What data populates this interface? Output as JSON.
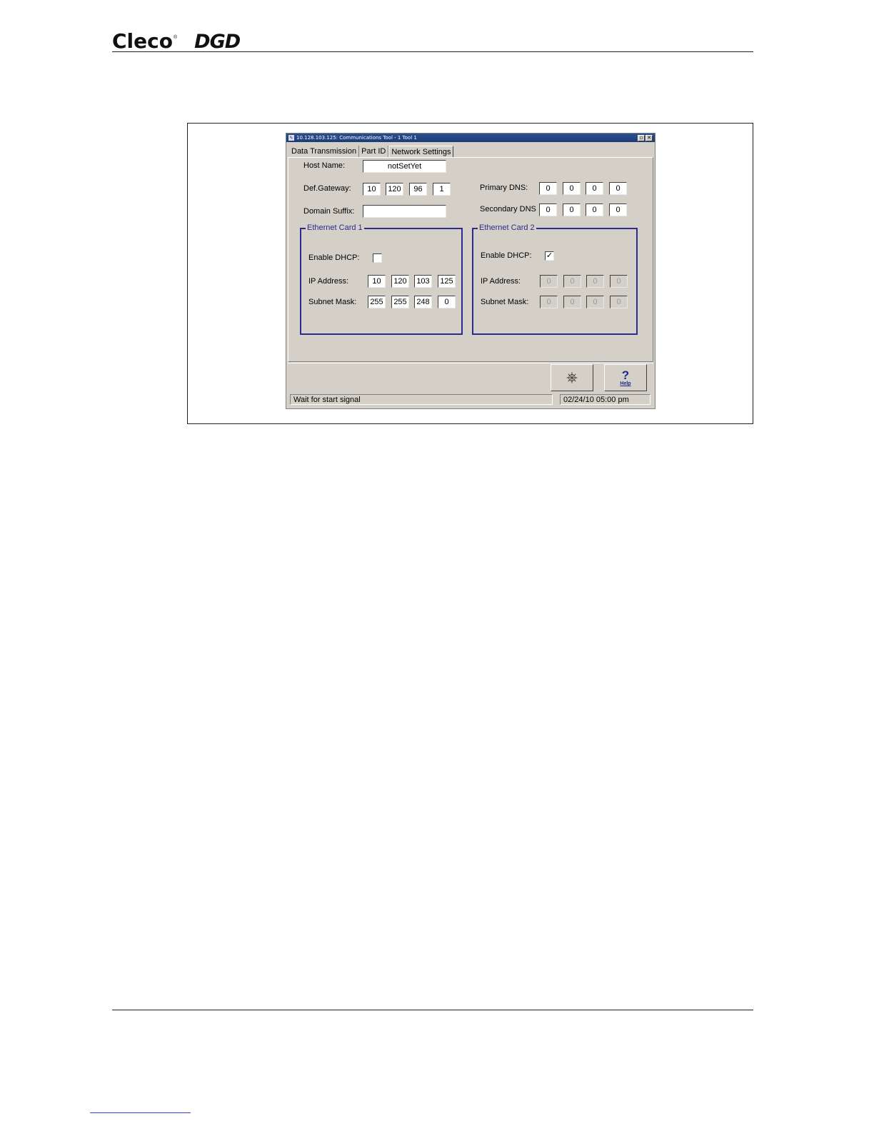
{
  "header": {
    "brand_primary": "Cleco",
    "brand_reg": "®",
    "brand_secondary": "DGD"
  },
  "window": {
    "title": "10.128.103.125: Communications   Tool - 1   Tool 1",
    "buttons": {
      "restore": "▫",
      "close": "✕"
    }
  },
  "tabs": [
    "Data Transmission",
    "Part ID",
    "Network Settings"
  ],
  "form": {
    "host_name_label": "Host Name:",
    "host_name_value": "notSetYet",
    "def_gateway_label": "Def.Gateway:",
    "def_gateway": [
      "10",
      "120",
      "96",
      "1"
    ],
    "domain_suffix_label": "Domain Suffix:",
    "domain_suffix_value": "",
    "primary_dns_label": "Primary DNS:",
    "primary_dns": [
      "0",
      "0",
      "0",
      "0"
    ],
    "secondary_dns_label": "Secondary DNS",
    "secondary_dns": [
      "0",
      "0",
      "0",
      "0"
    ]
  },
  "card1": {
    "title": "Ethernet Card 1",
    "dhcp_label": "Enable DHCP:",
    "dhcp_checked": "",
    "ip_label": "IP Address:",
    "ip": [
      "10",
      "120",
      "103",
      "125"
    ],
    "mask_label": "Subnet Mask:",
    "mask": [
      "255",
      "255",
      "248",
      "0"
    ]
  },
  "card2": {
    "title": "Ethernet Card 2",
    "dhcp_label": "Enable DHCP:",
    "dhcp_checked": "✓",
    "ip_label": "IP Address:",
    "ip": [
      "0",
      "0",
      "0",
      "0"
    ],
    "mask_label": "Subnet Mask:",
    "mask": [
      "0",
      "0",
      "0",
      "0"
    ]
  },
  "toolbar": {
    "network_icon": "⎈",
    "help_symbol": "?",
    "help_label": "Help"
  },
  "status": {
    "message": "Wait for start signal",
    "datetime": "02/24/10 05:00 pm"
  }
}
